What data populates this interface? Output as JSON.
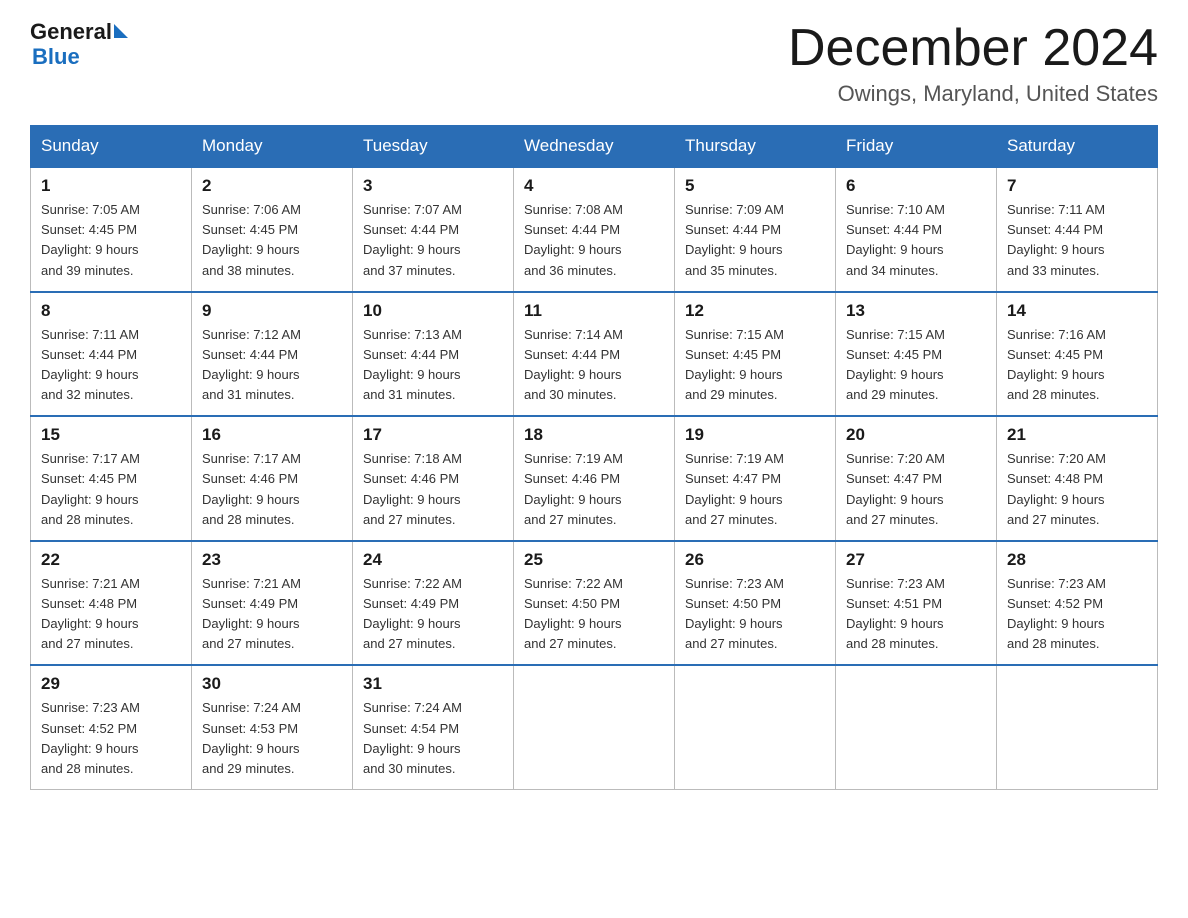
{
  "header": {
    "logo_line1": "General",
    "logo_line2": "Blue",
    "month_title": "December 2024",
    "location": "Owings, Maryland, United States"
  },
  "weekdays": [
    "Sunday",
    "Monday",
    "Tuesday",
    "Wednesday",
    "Thursday",
    "Friday",
    "Saturday"
  ],
  "weeks": [
    [
      {
        "day": "1",
        "sunrise": "7:05 AM",
        "sunset": "4:45 PM",
        "daylight": "9 hours and 39 minutes."
      },
      {
        "day": "2",
        "sunrise": "7:06 AM",
        "sunset": "4:45 PM",
        "daylight": "9 hours and 38 minutes."
      },
      {
        "day": "3",
        "sunrise": "7:07 AM",
        "sunset": "4:44 PM",
        "daylight": "9 hours and 37 minutes."
      },
      {
        "day": "4",
        "sunrise": "7:08 AM",
        "sunset": "4:44 PM",
        "daylight": "9 hours and 36 minutes."
      },
      {
        "day": "5",
        "sunrise": "7:09 AM",
        "sunset": "4:44 PM",
        "daylight": "9 hours and 35 minutes."
      },
      {
        "day": "6",
        "sunrise": "7:10 AM",
        "sunset": "4:44 PM",
        "daylight": "9 hours and 34 minutes."
      },
      {
        "day": "7",
        "sunrise": "7:11 AM",
        "sunset": "4:44 PM",
        "daylight": "9 hours and 33 minutes."
      }
    ],
    [
      {
        "day": "8",
        "sunrise": "7:11 AM",
        "sunset": "4:44 PM",
        "daylight": "9 hours and 32 minutes."
      },
      {
        "day": "9",
        "sunrise": "7:12 AM",
        "sunset": "4:44 PM",
        "daylight": "9 hours and 31 minutes."
      },
      {
        "day": "10",
        "sunrise": "7:13 AM",
        "sunset": "4:44 PM",
        "daylight": "9 hours and 31 minutes."
      },
      {
        "day": "11",
        "sunrise": "7:14 AM",
        "sunset": "4:44 PM",
        "daylight": "9 hours and 30 minutes."
      },
      {
        "day": "12",
        "sunrise": "7:15 AM",
        "sunset": "4:45 PM",
        "daylight": "9 hours and 29 minutes."
      },
      {
        "day": "13",
        "sunrise": "7:15 AM",
        "sunset": "4:45 PM",
        "daylight": "9 hours and 29 minutes."
      },
      {
        "day": "14",
        "sunrise": "7:16 AM",
        "sunset": "4:45 PM",
        "daylight": "9 hours and 28 minutes."
      }
    ],
    [
      {
        "day": "15",
        "sunrise": "7:17 AM",
        "sunset": "4:45 PM",
        "daylight": "9 hours and 28 minutes."
      },
      {
        "day": "16",
        "sunrise": "7:17 AM",
        "sunset": "4:46 PM",
        "daylight": "9 hours and 28 minutes."
      },
      {
        "day": "17",
        "sunrise": "7:18 AM",
        "sunset": "4:46 PM",
        "daylight": "9 hours and 27 minutes."
      },
      {
        "day": "18",
        "sunrise": "7:19 AM",
        "sunset": "4:46 PM",
        "daylight": "9 hours and 27 minutes."
      },
      {
        "day": "19",
        "sunrise": "7:19 AM",
        "sunset": "4:47 PM",
        "daylight": "9 hours and 27 minutes."
      },
      {
        "day": "20",
        "sunrise": "7:20 AM",
        "sunset": "4:47 PM",
        "daylight": "9 hours and 27 minutes."
      },
      {
        "day": "21",
        "sunrise": "7:20 AM",
        "sunset": "4:48 PM",
        "daylight": "9 hours and 27 minutes."
      }
    ],
    [
      {
        "day": "22",
        "sunrise": "7:21 AM",
        "sunset": "4:48 PM",
        "daylight": "9 hours and 27 minutes."
      },
      {
        "day": "23",
        "sunrise": "7:21 AM",
        "sunset": "4:49 PM",
        "daylight": "9 hours and 27 minutes."
      },
      {
        "day": "24",
        "sunrise": "7:22 AM",
        "sunset": "4:49 PM",
        "daylight": "9 hours and 27 minutes."
      },
      {
        "day": "25",
        "sunrise": "7:22 AM",
        "sunset": "4:50 PM",
        "daylight": "9 hours and 27 minutes."
      },
      {
        "day": "26",
        "sunrise": "7:23 AM",
        "sunset": "4:50 PM",
        "daylight": "9 hours and 27 minutes."
      },
      {
        "day": "27",
        "sunrise": "7:23 AM",
        "sunset": "4:51 PM",
        "daylight": "9 hours and 28 minutes."
      },
      {
        "day": "28",
        "sunrise": "7:23 AM",
        "sunset": "4:52 PM",
        "daylight": "9 hours and 28 minutes."
      }
    ],
    [
      {
        "day": "29",
        "sunrise": "7:23 AM",
        "sunset": "4:52 PM",
        "daylight": "9 hours and 28 minutes."
      },
      {
        "day": "30",
        "sunrise": "7:24 AM",
        "sunset": "4:53 PM",
        "daylight": "9 hours and 29 minutes."
      },
      {
        "day": "31",
        "sunrise": "7:24 AM",
        "sunset": "4:54 PM",
        "daylight": "9 hours and 30 minutes."
      },
      null,
      null,
      null,
      null
    ]
  ],
  "labels": {
    "sunrise": "Sunrise: ",
    "sunset": "Sunset: ",
    "daylight": "Daylight: "
  }
}
